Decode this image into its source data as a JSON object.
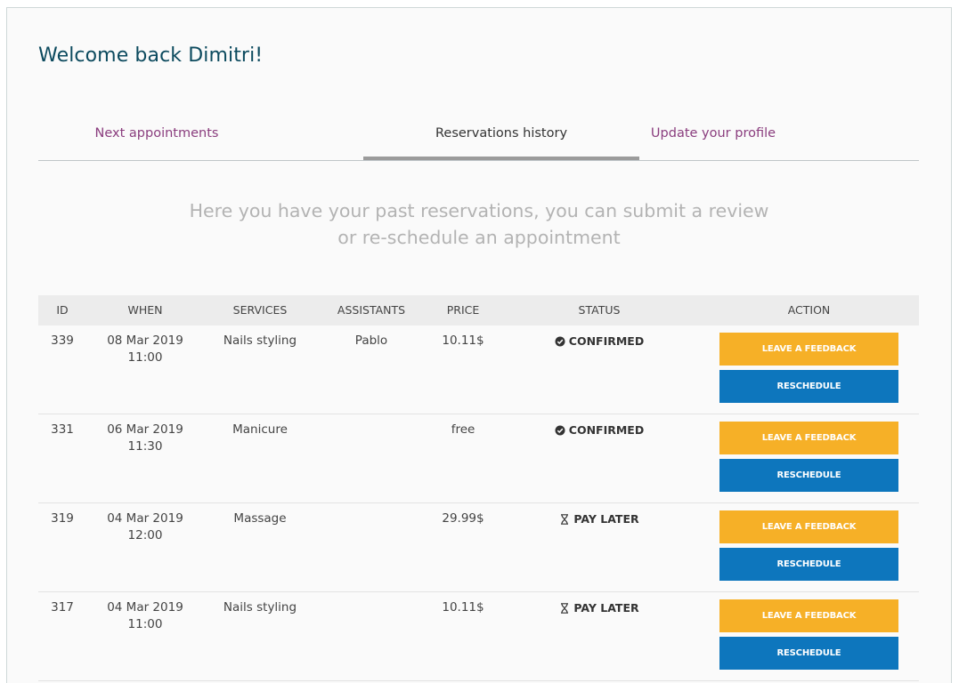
{
  "greeting": "Welcome back Dimitri!",
  "tabs": [
    {
      "label": "Next appointments",
      "active": false
    },
    {
      "label": "Reservations history",
      "active": true
    },
    {
      "label": "Update your profile",
      "active": false
    }
  ],
  "intro_text": "Here you have your past reservations, you can submit a review or re-schedule an appointment",
  "table": {
    "columns": [
      "ID",
      "WHEN",
      "SERVICES",
      "ASSISTANTS",
      "PRICE",
      "STATUS",
      "ACTION"
    ],
    "rows": [
      {
        "id": "339",
        "date": "08 Mar 2019",
        "time": "11:00",
        "service": "Nails styling",
        "assistant": "Pablo",
        "price": "10.11$",
        "status": "CONFIRMED",
        "status_icon": "check-circle-icon"
      },
      {
        "id": "331",
        "date": "06 Mar 2019",
        "time": "11:30",
        "service": "Manicure",
        "assistant": "",
        "price": "free",
        "status": "CONFIRMED",
        "status_icon": "check-circle-icon"
      },
      {
        "id": "319",
        "date": "04 Mar 2019",
        "time": "12:00",
        "service": "Massage",
        "assistant": "",
        "price": "29.99$",
        "status": "PAY LATER",
        "status_icon": "hourglass-icon"
      },
      {
        "id": "317",
        "date": "04 Mar 2019",
        "time": "11:00",
        "service": "Nails styling",
        "assistant": "",
        "price": "10.11$",
        "status": "PAY LATER",
        "status_icon": "hourglass-icon"
      }
    ]
  },
  "actions": {
    "feedback_label": "LEAVE A FEEDBACK",
    "reschedule_label": "RESCHEDULE"
  },
  "colors": {
    "heading": "#0c4a5e",
    "tab_link": "#8a3d7e",
    "feedback_button": "#f6b027",
    "reschedule_button": "#0d76bd"
  }
}
